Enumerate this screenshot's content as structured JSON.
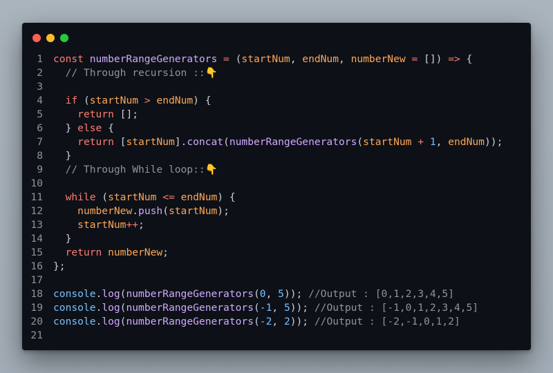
{
  "window": {
    "colors": {
      "background": "#0d1117",
      "red": "#ff5f57",
      "yellow": "#febc2e",
      "green": "#28c840"
    }
  },
  "colors": {
    "keyword": "#ff7b72",
    "function": "#d2a8ff",
    "variable": "#ffa657",
    "number": "#79c0ff",
    "comment": "#8b949e",
    "text": "#c9d1d9"
  },
  "lines": [
    {
      "number": "1",
      "tokens": [
        {
          "t": "const ",
          "k": "keyword"
        },
        {
          "t": "numberRangeGenerators",
          "k": "func"
        },
        {
          "t": " ",
          "k": "plain"
        },
        {
          "t": "=",
          "k": "keyword"
        },
        {
          "t": " (",
          "k": "punct"
        },
        {
          "t": "startNum",
          "k": "param"
        },
        {
          "t": ", ",
          "k": "punct"
        },
        {
          "t": "endNum",
          "k": "param"
        },
        {
          "t": ", ",
          "k": "punct"
        },
        {
          "t": "numberNew",
          "k": "param"
        },
        {
          "t": " ",
          "k": "plain"
        },
        {
          "t": "=",
          "k": "keyword"
        },
        {
          "t": " []) ",
          "k": "punct"
        },
        {
          "t": "=>",
          "k": "keyword"
        },
        {
          "t": " {",
          "k": "punct"
        }
      ]
    },
    {
      "number": "2",
      "tokens": [
        {
          "t": "  // Through recursion ::👇",
          "k": "comment"
        }
      ]
    },
    {
      "number": "3",
      "tokens": []
    },
    {
      "number": "4",
      "tokens": [
        {
          "t": "  ",
          "k": "plain"
        },
        {
          "t": "if",
          "k": "keyword"
        },
        {
          "t": " (",
          "k": "punct"
        },
        {
          "t": "startNum",
          "k": "param"
        },
        {
          "t": " ",
          "k": "plain"
        },
        {
          "t": ">",
          "k": "keyword"
        },
        {
          "t": " ",
          "k": "plain"
        },
        {
          "t": "endNum",
          "k": "param"
        },
        {
          "t": ") {",
          "k": "punct"
        }
      ]
    },
    {
      "number": "5",
      "tokens": [
        {
          "t": "    ",
          "k": "plain"
        },
        {
          "t": "return",
          "k": "keyword"
        },
        {
          "t": " [];",
          "k": "punct"
        }
      ]
    },
    {
      "number": "6",
      "tokens": [
        {
          "t": "  } ",
          "k": "punct"
        },
        {
          "t": "else",
          "k": "keyword"
        },
        {
          "t": " {",
          "k": "punct"
        }
      ]
    },
    {
      "number": "7",
      "tokens": [
        {
          "t": "    ",
          "k": "plain"
        },
        {
          "t": "return",
          "k": "keyword"
        },
        {
          "t": " [",
          "k": "punct"
        },
        {
          "t": "startNum",
          "k": "param"
        },
        {
          "t": "].",
          "k": "punct"
        },
        {
          "t": "concat",
          "k": "func"
        },
        {
          "t": "(",
          "k": "punct"
        },
        {
          "t": "numberRangeGenerators",
          "k": "func"
        },
        {
          "t": "(",
          "k": "punct"
        },
        {
          "t": "startNum",
          "k": "param"
        },
        {
          "t": " ",
          "k": "plain"
        },
        {
          "t": "+",
          "k": "keyword"
        },
        {
          "t": " ",
          "k": "plain"
        },
        {
          "t": "1",
          "k": "number"
        },
        {
          "t": ", ",
          "k": "punct"
        },
        {
          "t": "endNum",
          "k": "param"
        },
        {
          "t": "));",
          "k": "punct"
        }
      ]
    },
    {
      "number": "8",
      "tokens": [
        {
          "t": "  }",
          "k": "punct"
        }
      ]
    },
    {
      "number": "9",
      "tokens": [
        {
          "t": "  // Through While loop::👇",
          "k": "comment"
        }
      ]
    },
    {
      "number": "10",
      "tokens": []
    },
    {
      "number": "11",
      "tokens": [
        {
          "t": "  ",
          "k": "plain"
        },
        {
          "t": "while",
          "k": "keyword"
        },
        {
          "t": " (",
          "k": "punct"
        },
        {
          "t": "startNum",
          "k": "param"
        },
        {
          "t": " ",
          "k": "plain"
        },
        {
          "t": "<=",
          "k": "keyword"
        },
        {
          "t": " ",
          "k": "plain"
        },
        {
          "t": "endNum",
          "k": "param"
        },
        {
          "t": ") {",
          "k": "punct"
        }
      ]
    },
    {
      "number": "12",
      "tokens": [
        {
          "t": "    ",
          "k": "plain"
        },
        {
          "t": "numberNew",
          "k": "param"
        },
        {
          "t": ".",
          "k": "punct"
        },
        {
          "t": "push",
          "k": "func"
        },
        {
          "t": "(",
          "k": "punct"
        },
        {
          "t": "startNum",
          "k": "param"
        },
        {
          "t": ");",
          "k": "punct"
        }
      ]
    },
    {
      "number": "13",
      "tokens": [
        {
          "t": "    ",
          "k": "plain"
        },
        {
          "t": "startNum",
          "k": "param"
        },
        {
          "t": "++",
          "k": "keyword"
        },
        {
          "t": ";",
          "k": "punct"
        }
      ]
    },
    {
      "number": "14",
      "tokens": [
        {
          "t": "  }",
          "k": "punct"
        }
      ]
    },
    {
      "number": "15",
      "tokens": [
        {
          "t": "  ",
          "k": "plain"
        },
        {
          "t": "return",
          "k": "keyword"
        },
        {
          "t": " ",
          "k": "plain"
        },
        {
          "t": "numberNew",
          "k": "param"
        },
        {
          "t": ";",
          "k": "punct"
        }
      ]
    },
    {
      "number": "16",
      "tokens": [
        {
          "t": "};",
          "k": "punct"
        }
      ]
    },
    {
      "number": "17",
      "tokens": []
    },
    {
      "number": "18",
      "tokens": [
        {
          "t": "console",
          "k": "builtin"
        },
        {
          "t": ".",
          "k": "punct"
        },
        {
          "t": "log",
          "k": "func"
        },
        {
          "t": "(",
          "k": "punct"
        },
        {
          "t": "numberRangeGenerators",
          "k": "func"
        },
        {
          "t": "(",
          "k": "punct"
        },
        {
          "t": "0",
          "k": "number"
        },
        {
          "t": ", ",
          "k": "punct"
        },
        {
          "t": "5",
          "k": "number"
        },
        {
          "t": ")); ",
          "k": "punct"
        },
        {
          "t": "//Output : [0,1,2,3,4,5]",
          "k": "comment"
        }
      ]
    },
    {
      "number": "19",
      "tokens": [
        {
          "t": "console",
          "k": "builtin"
        },
        {
          "t": ".",
          "k": "punct"
        },
        {
          "t": "log",
          "k": "func"
        },
        {
          "t": "(",
          "k": "punct"
        },
        {
          "t": "numberRangeGenerators",
          "k": "func"
        },
        {
          "t": "(",
          "k": "punct"
        },
        {
          "t": "-1",
          "k": "number"
        },
        {
          "t": ", ",
          "k": "punct"
        },
        {
          "t": "5",
          "k": "number"
        },
        {
          "t": ")); ",
          "k": "punct"
        },
        {
          "t": "//Output : [-1,0,1,2,3,4,5]",
          "k": "comment"
        }
      ]
    },
    {
      "number": "20",
      "tokens": [
        {
          "t": "console",
          "k": "builtin"
        },
        {
          "t": ".",
          "k": "punct"
        },
        {
          "t": "log",
          "k": "func"
        },
        {
          "t": "(",
          "k": "punct"
        },
        {
          "t": "numberRangeGenerators",
          "k": "func"
        },
        {
          "t": "(",
          "k": "punct"
        },
        {
          "t": "-2",
          "k": "number"
        },
        {
          "t": ", ",
          "k": "punct"
        },
        {
          "t": "2",
          "k": "number"
        },
        {
          "t": ")); ",
          "k": "punct"
        },
        {
          "t": "//Output : [-2,-1,0,1,2]",
          "k": "comment"
        }
      ]
    },
    {
      "number": "21",
      "tokens": []
    }
  ]
}
